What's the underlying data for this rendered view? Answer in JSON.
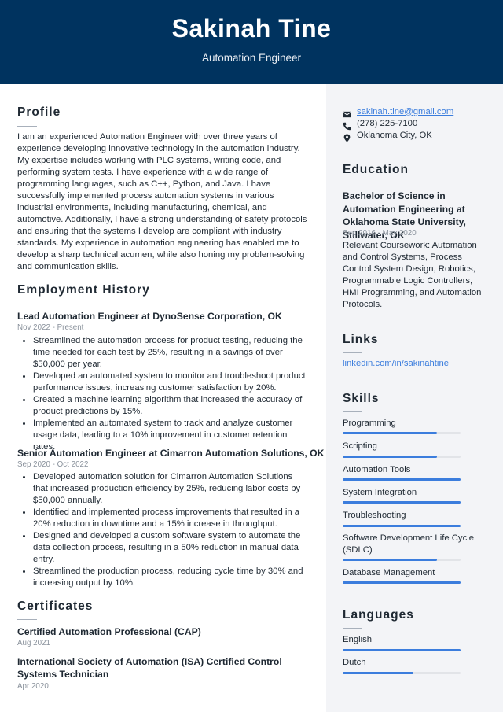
{
  "header": {
    "name": "Sakinah Tine",
    "job_title": "Automation Engineer",
    "background_color": "#00335f"
  },
  "profile": {
    "title": "Profile",
    "text": "I am an experienced Automation Engineer with over three years of experience developing innovative technology in the automation industry. My expertise includes working with PLC systems, writing code, and performing system tests. I have experience with a wide range of programming languages, such as C++, Python, and Java. I have successfully implemented process automation systems in various industrial environments, including manufacturing, chemical, and automotive. Additionally, I have a strong understanding of safety protocols and ensuring that the systems I develop are compliant with industry standards. My experience in automation engineering has enabled me to develop a sharp technical acumen, while also honing my problem-solving and communication skills."
  },
  "employment": {
    "title": "Employment History",
    "jobs": [
      {
        "title": "Lead Automation Engineer at DynoSense Corporation, OK",
        "dates": "Nov 2022 - Present",
        "bullets": [
          "Streamlined the automation process for product testing, reducing the time needed for each test by 25%, resulting in a savings of over $50,000 per year.",
          "Developed an automated system to monitor and troubleshoot product performance issues, increasing customer satisfaction by 20%.",
          "Created a machine learning algorithm that increased the accuracy of product predictions by 15%.",
          "Implemented an automated system to track and analyze customer usage data, leading to a 10% improvement in customer retention rates."
        ]
      },
      {
        "title": "Senior Automation Engineer at Cimarron Automation Solutions, OK",
        "dates": "Sep 2020 - Oct 2022",
        "bullets": [
          "Developed automation solution for Cimarron Automation Solutions that increased production efficiency by 25%, reducing labor costs by $50,000 annually.",
          "Identified and implemented process improvements that resulted in a 20% reduction in downtime and a 15% increase in throughput.",
          "Designed and developed a custom software system to automate the data collection process, resulting in a 50% reduction in manual data entry.",
          "Streamlined the production process, reducing cycle time by 30% and increasing output by 10%."
        ]
      }
    ]
  },
  "certificates": {
    "title": "Certificates",
    "items": [
      {
        "name": "Certified Automation Professional (CAP)",
        "date": "Aug 2021"
      },
      {
        "name": "International Society of Automation (ISA) Certified Control Systems Technician",
        "date": "Apr 2020"
      }
    ]
  },
  "contact": {
    "email": "sakinah.tine@gmail.com",
    "phone": "(278) 225-7100",
    "location": "Oklahoma City, OK",
    "icons": [
      "envelope-icon",
      "phone-icon",
      "map-pin-icon"
    ]
  },
  "education": {
    "title": "Education",
    "degree": "Bachelor of Science in Automation Engineering at Oklahoma State University, Stillwater, OK",
    "dates": "Sep 2016 - May 2020",
    "description": "Relevant Coursework: Automation and Control Systems, Process Control System Design, Robotics, Programmable Logic Controllers, HMI Programming, and Automation Protocols."
  },
  "links": {
    "title": "Links",
    "items": [
      "linkedin.com/in/sakinahtine"
    ]
  },
  "skills": {
    "title": "Skills",
    "items": [
      {
        "name": "Programming",
        "level": 0.8
      },
      {
        "name": "Scripting",
        "level": 0.8
      },
      {
        "name": "Automation Tools",
        "level": 1.0
      },
      {
        "name": "System Integration",
        "level": 1.0
      },
      {
        "name": "Troubleshooting",
        "level": 1.0
      },
      {
        "name": "Software Development Life Cycle (SDLC)",
        "level": 0.8
      },
      {
        "name": "Database Management",
        "level": 1.0
      }
    ]
  },
  "languages": {
    "title": "Languages",
    "items": [
      {
        "name": "English",
        "level": 1.0
      },
      {
        "name": "Dutch",
        "level": 0.6
      }
    ]
  },
  "colors": {
    "accent": "#3b7ddd",
    "sidebar_bg": "#f3f4f7",
    "bar_track": "#e2e4e8"
  }
}
